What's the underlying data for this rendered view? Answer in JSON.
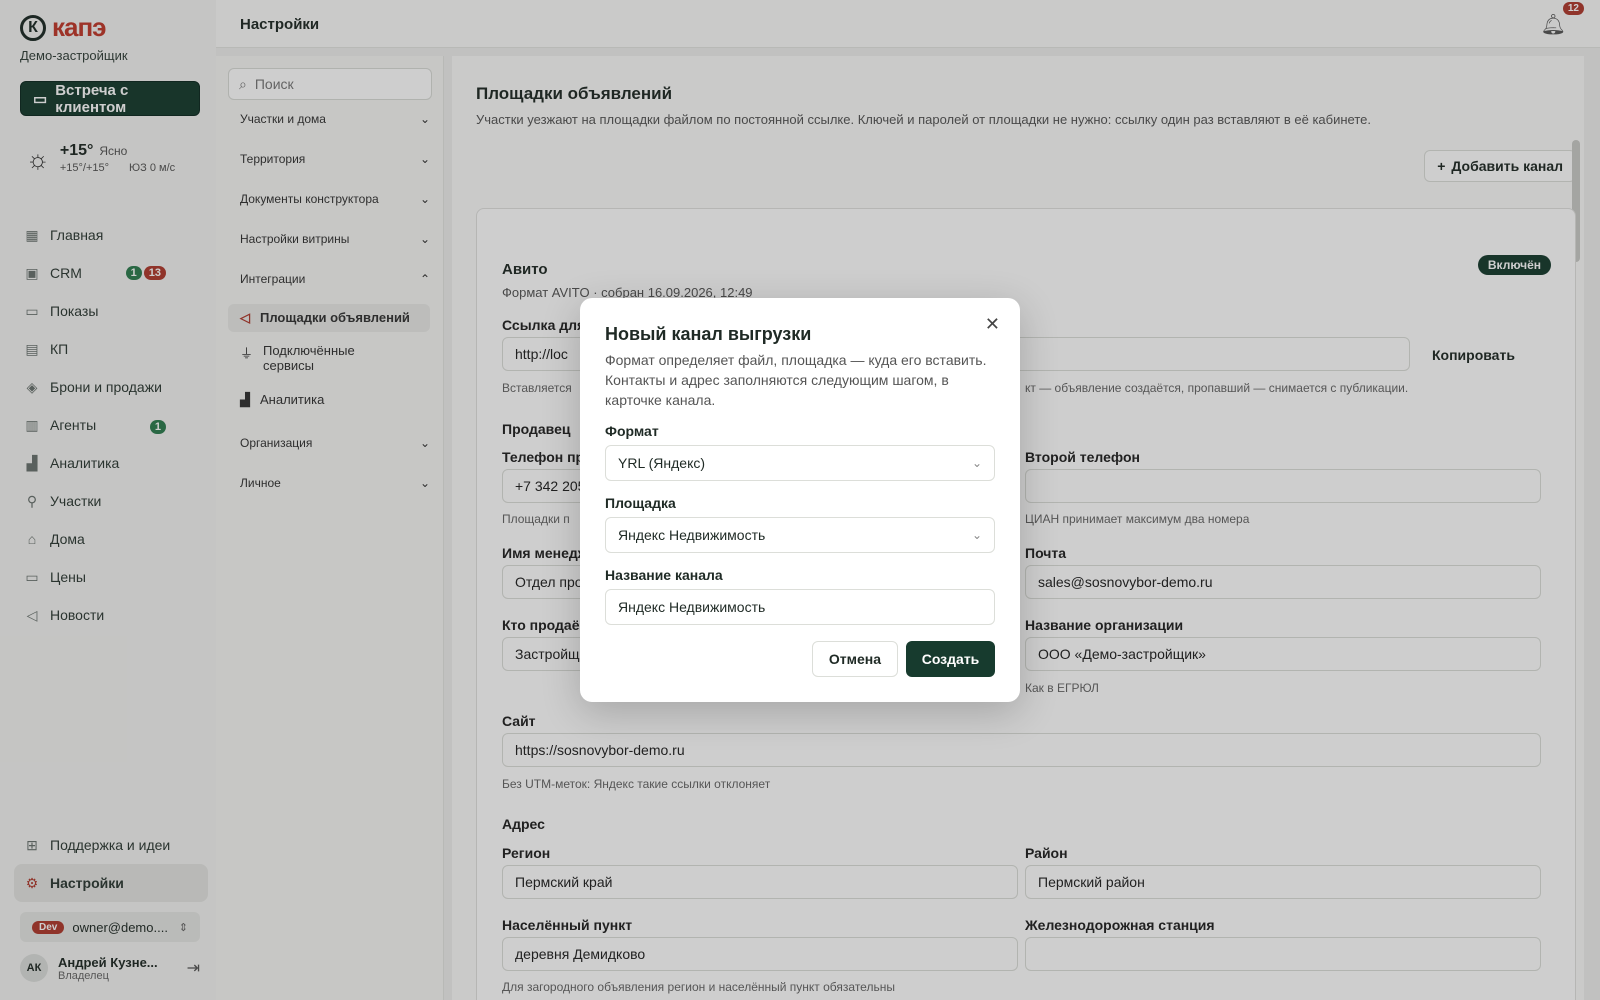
{
  "brand": {
    "logo_text": "капэ",
    "org_name": "Демо-застройщик"
  },
  "meet_button": {
    "label": "Встреча с клиентом"
  },
  "weather": {
    "temp": "+15°",
    "desc": "Ясно",
    "range": "+15°/+15°",
    "wind": "ЮЗ 0 м/с"
  },
  "nav": {
    "items": [
      {
        "label": "Главная",
        "icon": "grid-icon"
      },
      {
        "label": "CRM",
        "icon": "crm-icon",
        "badge_green": "1",
        "badge_red": "13"
      },
      {
        "label": "Показы",
        "icon": "monitor-icon"
      },
      {
        "label": "КП",
        "icon": "document-icon"
      },
      {
        "label": "Брони и продажи",
        "icon": "tag-icon"
      },
      {
        "label": "Агенты",
        "icon": "agents-icon",
        "badge_green": "1"
      },
      {
        "label": "Аналитика",
        "icon": "chart-icon"
      },
      {
        "label": "Участки",
        "icon": "plot-icon"
      },
      {
        "label": "Дома",
        "icon": "house-icon"
      },
      {
        "label": "Цены",
        "icon": "price-icon"
      },
      {
        "label": "Новости",
        "icon": "megaphone-icon"
      }
    ],
    "support": "Поддержка и идеи",
    "settings": "Настройки"
  },
  "account": {
    "env": "Dev",
    "email": "owner@demo...."
  },
  "user": {
    "initials": "АК",
    "name": "Андрей Кузне...",
    "role": "Владелец"
  },
  "topbar": {
    "title": "Настройки",
    "notif_count": "12"
  },
  "settings_nav": {
    "search_placeholder": "Поиск",
    "groups": [
      "Участки и дома",
      "Территория",
      "Документы конструктора",
      "Настройки витрины",
      "Интеграции",
      "Организация",
      "Личное"
    ],
    "sub": [
      "Площадки объявлений",
      "Подключённые сервисы",
      "Аналитика"
    ]
  },
  "main": {
    "title": "Площадки объявлений",
    "desc": "Участки уезжают на площадки файлом по постоянной ссылке. Ключей и паролей от площадки не нужно: ссылку один раз вставляют в её кабинете.",
    "add_channel": "Добавить канал",
    "channel": {
      "name": "Авито",
      "meta": "Формат AVITO · собран 16.09.2026, 12:49",
      "status": "Включён",
      "link_label": "Ссылка для",
      "link_value": "http://loc",
      "copy": "Копировать",
      "link_hint_left": "Вставляется",
      "link_hint_right": "кт — объявление создаётся, пропавший — снимается с публикации.",
      "seller": "Продавец",
      "phone_label": "Телефон пр",
      "phone_value": "+7 342 205",
      "phone_hint": "Площадки п",
      "second_phone_label": "Второй телефон",
      "second_phone_hint": "ЦИАН принимает максимум два номера",
      "manager_label": "Имя менедж",
      "manager_value": "Отдел про",
      "email_label": "Почта",
      "email_value": "sales@sosnovybor-demo.ru",
      "who_label": "Кто продаё",
      "who_value": "Застройщ",
      "org_label": "Название организации",
      "org_value": "ООО «Демо-застройщик»",
      "org_hint": "Как в ЕГРЮЛ",
      "site_label": "Сайт",
      "site_value": "https://sosnovybor-demo.ru",
      "site_hint": "Без UTM-меток: Яндекс такие ссылки отклоняет",
      "address": "Адрес",
      "region_label": "Регион",
      "region_value": "Пермский край",
      "district_label": "Район",
      "district_value": "Пермский район",
      "locality_label": "Населённый пункт",
      "locality_value": "деревня Демидково",
      "station_label": "Железнодорожная станция",
      "address_hint": "Для загородного объявления регион и населённый пункт обязательны"
    }
  },
  "modal": {
    "title": "Новый канал выгрузки",
    "desc": "Формат определяет файл, площадка — куда его вставить. Контакты и адрес заполняются следующим шагом, в карточке канала.",
    "format_label": "Формат",
    "format_value": "YRL (Яндекс)",
    "platform_label": "Площадка",
    "platform_value": "Яндекс Недвижимость",
    "name_label": "Название канала",
    "name_value": "Яндекс Недвижимость",
    "cancel": "Отмена",
    "create": "Создать"
  }
}
